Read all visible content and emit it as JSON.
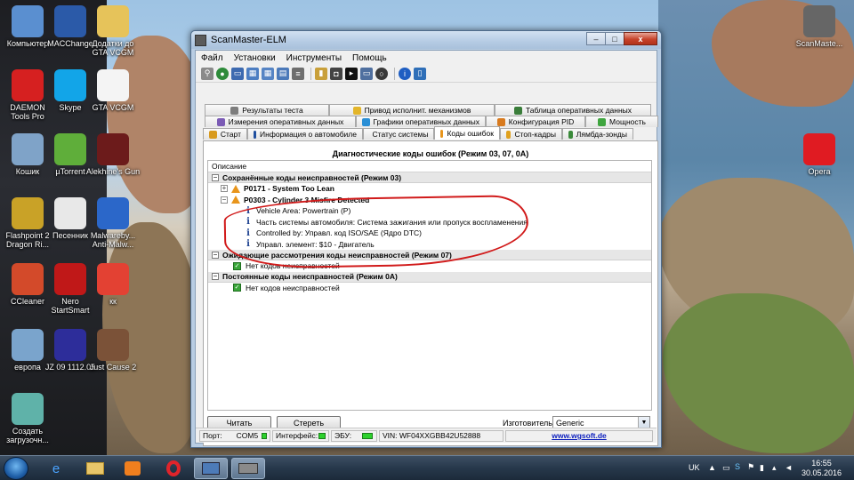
{
  "desktop": {
    "icons_left": [
      {
        "label": "Компьютер",
        "icon": "computer-icon",
        "color": "#5a8fd0"
      },
      {
        "label": "MACChange",
        "icon": "network-icon",
        "color": "#2b5aa8"
      },
      {
        "label": "Додатки до GTA VCGM",
        "icon": "folder-icon",
        "color": "#e6c35a"
      },
      {
        "label": "DAEMON Tools Pro",
        "icon": "daemon-icon",
        "color": "#d62020"
      },
      {
        "label": "Skype",
        "icon": "skype-icon",
        "color": "#12a5e8"
      },
      {
        "label": "GTA VCGM",
        "icon": "document-icon",
        "color": "#f4f4f4"
      },
      {
        "label": "Кошик",
        "icon": "recycle-bin-icon",
        "color": "#7fa3c8"
      },
      {
        "label": "µTorrent",
        "icon": "utorrent-icon",
        "color": "#5fae3a"
      },
      {
        "label": "Alekhine's Gun",
        "icon": "game-icon",
        "color": "#6c1b1b"
      },
      {
        "label": "Flashpoint 2 Dragon Ri...",
        "icon": "game-icon",
        "color": "#c9a227"
      },
      {
        "label": "Песенник",
        "icon": "document-icon",
        "color": "#e8e8e8"
      },
      {
        "label": "Malwareby... Anti-Malw...",
        "icon": "malwarebytes-icon",
        "color": "#2b67c9"
      },
      {
        "label": "CCleaner",
        "icon": "ccleaner-icon",
        "color": "#d34a2a"
      },
      {
        "label": "Nero StartSmart",
        "icon": "nero-icon",
        "color": "#c01818"
      },
      {
        "label": "кк",
        "icon": "chrome-icon",
        "color": "#e34133"
      },
      {
        "label": "европа",
        "icon": "image-icon",
        "color": "#7aa4cc"
      },
      {
        "label": "JZ 09 1112.05",
        "icon": "ag-icon",
        "color": "#2d2d9a"
      },
      {
        "label": "Just Cause 2",
        "icon": "game-icon",
        "color": "#7b5238"
      },
      {
        "label": "Создать загрузочн...",
        "icon": "usb-icon",
        "color": "#5fb2a9"
      }
    ],
    "icons_right": [
      {
        "label": "ScanMaste...",
        "icon": "chip-icon",
        "color": "#666666"
      },
      {
        "label": "Opera",
        "icon": "opera-icon",
        "color": "#e01b22"
      }
    ]
  },
  "window": {
    "title": "ScanMaster-ELM",
    "controls": {
      "minimize": "–",
      "maximize": "□",
      "close": "x"
    },
    "menu": [
      "Файл",
      "Установки",
      "Инструменты",
      "Помощь"
    ],
    "tabs_row1": [
      {
        "label": "Результаты теста",
        "icon": "gear-icon",
        "color": "#7d7d7d"
      },
      {
        "label": "Привод исполнит. механизмов",
        "icon": "lightbulb-icon",
        "color": "#e3b52a"
      },
      {
        "label": "Таблица оперативных данных",
        "icon": "table-icon",
        "color": "#3a7d3a"
      }
    ],
    "tabs_row2": [
      {
        "label": "Измерения оперативных данных",
        "icon": "gauge-icon",
        "color": "#7b5bb5"
      },
      {
        "label": "Графики оперативных данных",
        "icon": "chart-icon",
        "color": "#2a8fd6"
      },
      {
        "label": "Конфигурация PID",
        "icon": "config-icon",
        "color": "#d87a1e"
      },
      {
        "label": "Мощность",
        "icon": "power-icon",
        "color": "#3fa53f"
      }
    ],
    "tabs_row3": [
      {
        "label": "Старт",
        "icon": "start-icon",
        "color": "#d89a1e"
      },
      {
        "label": "Информация о автомобиле",
        "icon": "info-icon",
        "color": "#1f4f9f"
      },
      {
        "label": "Статус системы",
        "icon": "status-icon",
        "color": "#8c8c8c"
      },
      {
        "label": "Коды ошибок",
        "icon": "warning-icon",
        "color": "#e8951c",
        "active": true
      },
      {
        "label": "Стоп-кадры",
        "icon": "freeze-frame-icon",
        "color": "#e0a11e"
      },
      {
        "label": "Лямбда-зонды",
        "icon": "sensor-icon",
        "color": "#3a8a3a"
      }
    ],
    "panel": {
      "header": "Диагностические коды ошибок (Режим 03, 07, 0A)",
      "column": "Описание",
      "groups": [
        {
          "title": "Сохранённые коды неисправностей (Режим 03)",
          "codes": [
            {
              "code": "P0171",
              "desc": "System Too Lean",
              "expanded": false
            },
            {
              "code": "P0303",
              "desc": "Cylinder 3 Misfire Detected",
              "expanded": true,
              "details": [
                "Vehicle Area: Powertrain (P)",
                "Часть системы автомобиля: Система зажигания или пропуск воспламенения",
                "Controlled by: Управл. код ISO/SAE  (Ядро DTC)",
                "Управл. элемент: $10 - Двигатель"
              ]
            }
          ]
        },
        {
          "title": "Ожидающие рассмотрения коды неисправностей (Режим 07)",
          "none": "Нет кодов неисправностей"
        },
        {
          "title": "Постоянные коды неисправностей  (Режим 0A)",
          "none": "Нет кодов неисправностей"
        }
      ],
      "read_button": "Читать",
      "erase_button": "Стереть",
      "manufacturer_label": "Изготовитель",
      "manufacturer_value": "Generic"
    },
    "status": {
      "port_label": "Порт:",
      "port_value": "COM5",
      "interface_label": "Интерфейс:",
      "ecu_label": "ЭБУ:",
      "vin": "VIN: WF04XXGBB42U52888",
      "url": "www.wgsoft.de"
    }
  },
  "taskbar": {
    "lang": "UK",
    "time": "16:55",
    "date": "30.05.2016"
  }
}
